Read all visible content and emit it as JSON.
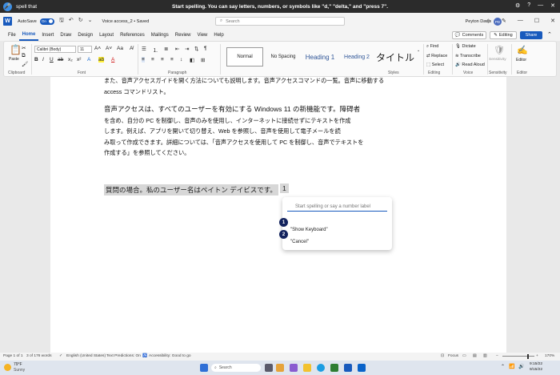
{
  "voice_access": {
    "app_name": "spell that",
    "message": "Start spelling. You can say letters, numbers, or symbols like \"d,\" \"delta,\" and \"press 7\"."
  },
  "title_bar": {
    "autosave_label": "AutoSave",
    "autosave_state": "On",
    "doc_name": "Voice access_2 • Saved",
    "search_placeholder": "Search",
    "user_name": "Peyton Davis",
    "avatar_initials": "PD"
  },
  "menu": {
    "tabs": [
      "File",
      "Home",
      "Insert",
      "Draw",
      "Design",
      "Layout",
      "References",
      "Mailings",
      "Review",
      "View",
      "Help"
    ],
    "comments_label": "Comments",
    "editing_label": "Editing",
    "share_label": "Share"
  },
  "ribbon": {
    "paste_label": "Paste",
    "font_name": "Calibri (Body)",
    "font_size": "11",
    "styles": [
      "Normal",
      "No Spacing",
      "Heading 1",
      "Heading 2",
      "タイトル"
    ],
    "find_label": "Find",
    "replace_label": "Replace",
    "select_label": "Select",
    "dictate_label": "Dictate",
    "transcribe_label": "Transcribe",
    "read_aloud_label": "Read Aloud",
    "sensitivity_label": "Sensitivity",
    "editor_label": "Editor",
    "groups": [
      "Clipboard",
      "Font",
      "Paragraph",
      "Styles",
      "Editing",
      "Voice",
      "Sensitivity",
      "Editor"
    ]
  },
  "document": {
    "lines": [
      "また、音声アクセスガイドを開く方法についても説明します。音声アクセスコマンドの一覧。音声に移動する",
      "access コマンドリスト。",
      "音声アクセスは、すべてのユーザーを有効にする Windows 11 の新機能です。障碍者",
      "を含め、自分の PC を制御し、音声のみを使用し、インターネットに接続せずにテキストを作成",
      "します。例えば、アプリを開いて切り替え、Web を参照し、音声を使用して電子メールを読",
      "み取って作成できます。詳細については、「音声アクセスを使用して PC を制御し、音声でテキストを",
      "作成する」を参照してください。"
    ],
    "question": "質問の場合。私のユーザー名はペイトン デイビスです。",
    "number_label": "1"
  },
  "spelling_popup": {
    "placeholder": "Start spelling or say a number label",
    "options": [
      {
        "number": "1",
        "label": ""
      },
      {
        "number": "2",
        "label": "\"Show Keyboard\""
      },
      {
        "number": "",
        "label": "\"Cancel\""
      }
    ]
  },
  "status_bar": {
    "page": "Page 1 of 1",
    "words": "3 of 176 words",
    "language": "English (United States)",
    "predictions": "Text Predictions: On",
    "accessibility": "Accessibility: Good to go",
    "focus": "Focus",
    "zoom": "170%"
  },
  "taskbar": {
    "weather_temp": "79°F",
    "weather_desc": "Sunny",
    "search_label": "Search",
    "time": "9:15/22",
    "date": "9/15/22"
  },
  "colors": {
    "accent": "#185abd",
    "badge": "#13235e",
    "voice_bar": "#2b2b2b"
  }
}
